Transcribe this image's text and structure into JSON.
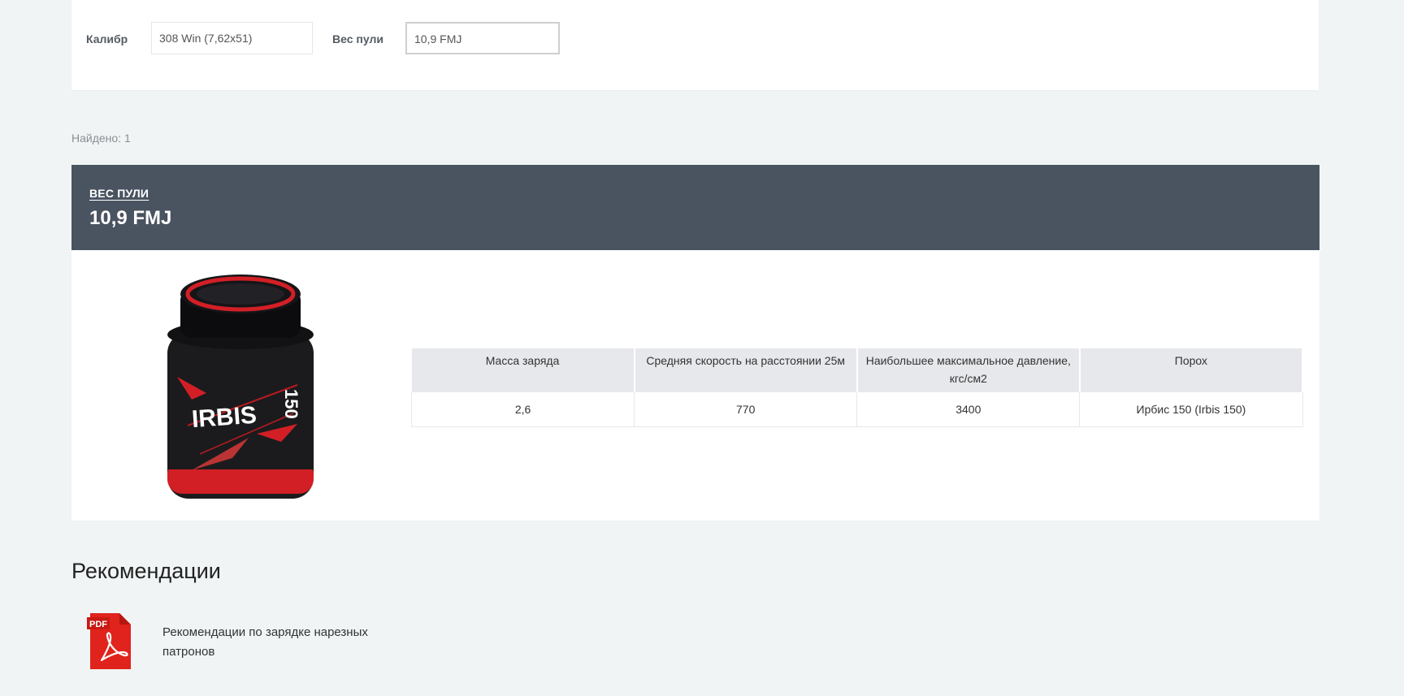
{
  "filters": {
    "caliber_label": "Калибр",
    "caliber_value": "308 Win (7,62x51)",
    "weight_label": "Вес пули",
    "weight_value": "10,9 FMJ"
  },
  "found_text": "Найдено: 1",
  "result": {
    "header_label": "ВЕС ПУЛИ",
    "header_value": "10,9 FMJ",
    "product_brand": "IRBIS",
    "product_number": "150",
    "table": {
      "headers": [
        "Масса заряда",
        "Средняя скорость на расстоянии 25м",
        "Наибольшее максимальное давление, кгс/см2",
        "Порох"
      ],
      "rows": [
        [
          "2,6",
          "770",
          "3400",
          "Ирбис 150 (Irbis 150)"
        ]
      ]
    }
  },
  "recommendations": {
    "title": "Рекомендации",
    "document_link": "Рекомендации по зарядке нарезных патронов",
    "icon_text": "PDF"
  },
  "colors": {
    "page_bg": "#f0f4f4",
    "header_bg": "#4a5360",
    "table_header_bg": "#e6e8eb",
    "pdf_red": "#e0231c"
  }
}
